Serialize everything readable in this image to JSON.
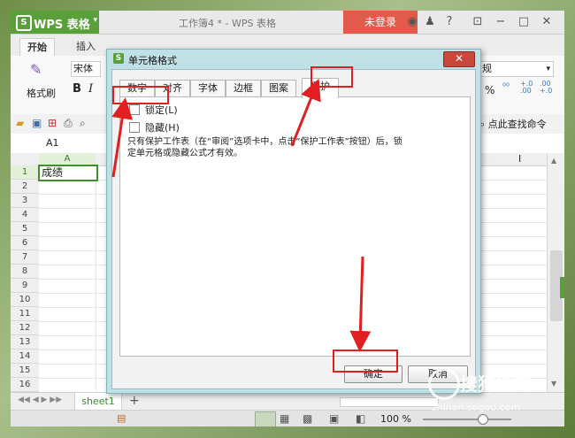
{
  "titlebar": {
    "app_name": "WPS 表格",
    "doc_title": "工作簿4 * - WPS 表格",
    "login_label": "未登录",
    "help_label": "?"
  },
  "ribbon": {
    "tabs": [
      "开始",
      "插入"
    ],
    "format_painter": "格式刷",
    "font_name": "宋体",
    "bold": "B",
    "italic": "I",
    "number_format": "规",
    "percent": "%",
    "find_cmd": "点此查找命令"
  },
  "formula_bar": {
    "cell_ref": "A1"
  },
  "grid": {
    "columns": [
      "A",
      "I"
    ],
    "rows": [
      "1",
      "2",
      "3",
      "4",
      "5",
      "6",
      "7",
      "8",
      "9",
      "10",
      "11",
      "12",
      "13",
      "14",
      "15",
      "16"
    ],
    "a1_value": "成绩"
  },
  "sheets": {
    "tab": "sheet1",
    "add": "+"
  },
  "status": {
    "zoom": "100 %"
  },
  "dialog": {
    "title": "单元格格式",
    "close": "✕",
    "tabs": [
      "数字",
      "对齐",
      "字体",
      "边框",
      "图案",
      "保护"
    ],
    "selected_tab": "保护",
    "lock_label": "锁定(L)",
    "hide_label": "隐藏(H)",
    "note_line1": "只有保护工作表（在“审阅”选项卡中，点击“保护工作表”按钮）后，锁",
    "note_line2": "定单元格或隐藏公式才有效。",
    "ok": "确定",
    "cancel": "取消"
  },
  "watermark": {
    "brand": "搜狗指南",
    "url": "zhinan.sogou.com"
  },
  "colors": {
    "accent_green": "#5aa03a",
    "login_red": "#e25a4a",
    "highlight": "#e02020",
    "dialog_frame": "#bfe0e5"
  }
}
